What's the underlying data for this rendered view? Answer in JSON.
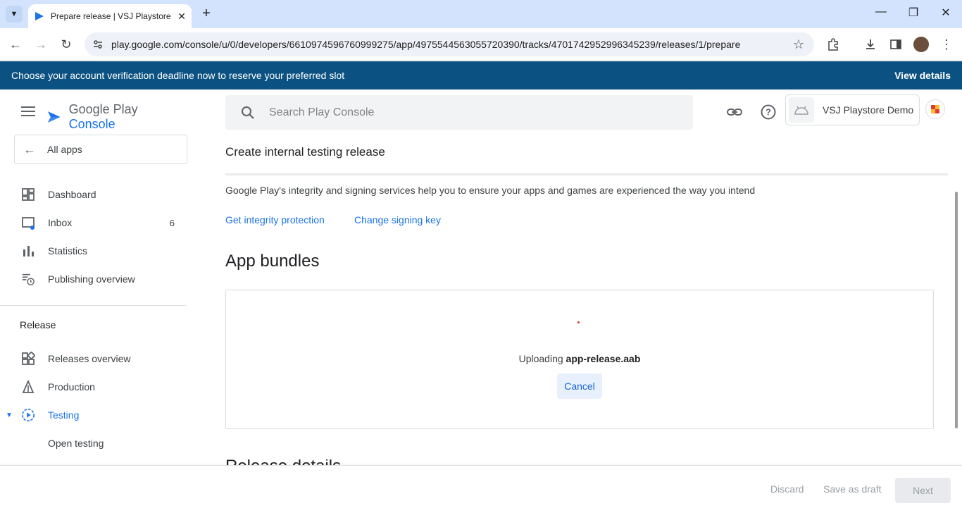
{
  "browser": {
    "tab_title": "Prepare release | VSJ Playstore D",
    "url": "play.google.com/console/u/0/developers/6610974596760999275/app/4975544563055720390/tracks/4701742952996345239/releases/1/prepare"
  },
  "banner": {
    "text": "Choose your account verification deadline now to reserve your preferred slot",
    "link": "View details"
  },
  "logo": {
    "google": "Google Play",
    "console": "Console"
  },
  "search": {
    "placeholder": "Search Play Console"
  },
  "app": {
    "name": "VSJ Playstore Demo"
  },
  "sidebar": {
    "all_apps": "All apps",
    "items": [
      {
        "label": "Dashboard"
      },
      {
        "label": "Inbox",
        "count": "6"
      },
      {
        "label": "Statistics"
      },
      {
        "label": "Publishing overview"
      }
    ],
    "section_release": "Release",
    "release_items": [
      {
        "label": "Releases overview"
      },
      {
        "label": "Production"
      },
      {
        "label": "Testing"
      },
      {
        "label": "Open testing"
      }
    ]
  },
  "main": {
    "heading": "Create internal testing release",
    "integrity_text": "Google Play's integrity and signing services help you to ensure your apps and games are experienced the way you intend",
    "link_integrity": "Get integrity protection",
    "link_signing": "Change signing key",
    "bundles_title": "App bundles",
    "uploading_prefix": "Uploading",
    "uploading_file": "app-release.aab",
    "cancel": "Cancel",
    "next_section": "Release details"
  },
  "actions": {
    "discard": "Discard",
    "save_draft": "Save as draft",
    "next": "Next"
  },
  "colors": {
    "banner": "#0b5283",
    "accent": "#1a73e8"
  }
}
